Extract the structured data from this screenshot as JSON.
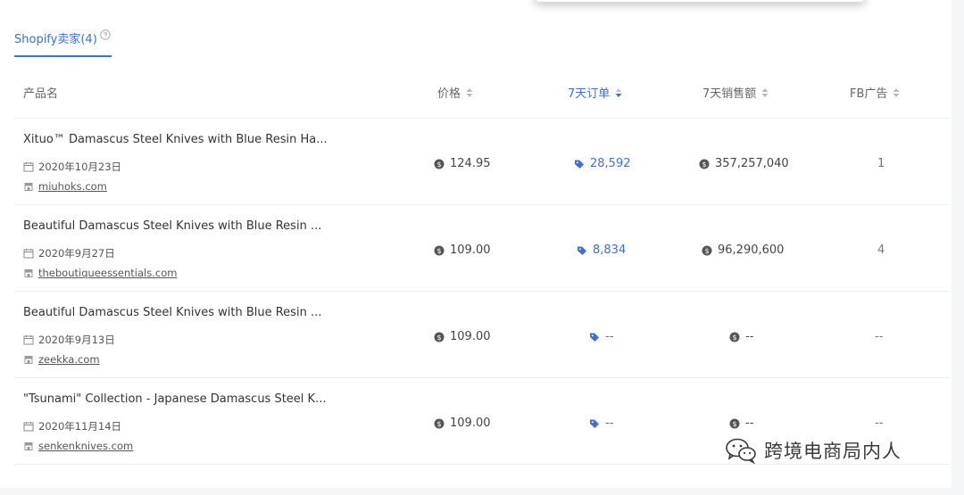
{
  "tab": {
    "label": "Shopify卖家(4)"
  },
  "columns": {
    "product": "产品名",
    "price": "价格",
    "orders_7d": "7天订单",
    "sales_7d": "7天销售额",
    "fb_ads": "FB广告"
  },
  "rows": [
    {
      "title": "Xituo™ Damascus Steel Knives with Blue Resin Ha...",
      "date": "2020年10月23日",
      "site": "miuhoks.com",
      "price": "124.95",
      "orders": "28,592",
      "sales": "357,257,040",
      "fb": "1"
    },
    {
      "title": "Beautiful Damascus Steel Knives with Blue Resin ...",
      "date": "2020年9月27日",
      "site": "theboutiqueessentials.com",
      "price": "109.00",
      "orders": "8,834",
      "sales": "96,290,600",
      "fb": "4"
    },
    {
      "title": "Beautiful Damascus Steel Knives with Blue Resin ...",
      "date": "2020年9月13日",
      "site": "zeekka.com",
      "price": "109.00",
      "orders": "--",
      "sales": "--",
      "fb": "--"
    },
    {
      "title": "\"Tsunami\" Collection - Japanese Damascus Steel K...",
      "date": "2020年11月14日",
      "site": "senkenknives.com",
      "price": "109.00",
      "orders": "--",
      "sales": "--",
      "fb": "--"
    }
  ],
  "watermark": {
    "text": "跨境电商局内人"
  },
  "colors": {
    "accent": "#3e6fd1",
    "text": "#333333",
    "muted": "#999999",
    "divider": "#eceef2"
  },
  "icons": {
    "tab": "help-circle-icon",
    "sort": "sort-icon",
    "date": "calendar-icon",
    "site": "store-icon",
    "price": "dollar-coin-icon",
    "orders": "tag-icon",
    "sales": "dollar-coin-icon",
    "watermark": "wechat-icon"
  }
}
